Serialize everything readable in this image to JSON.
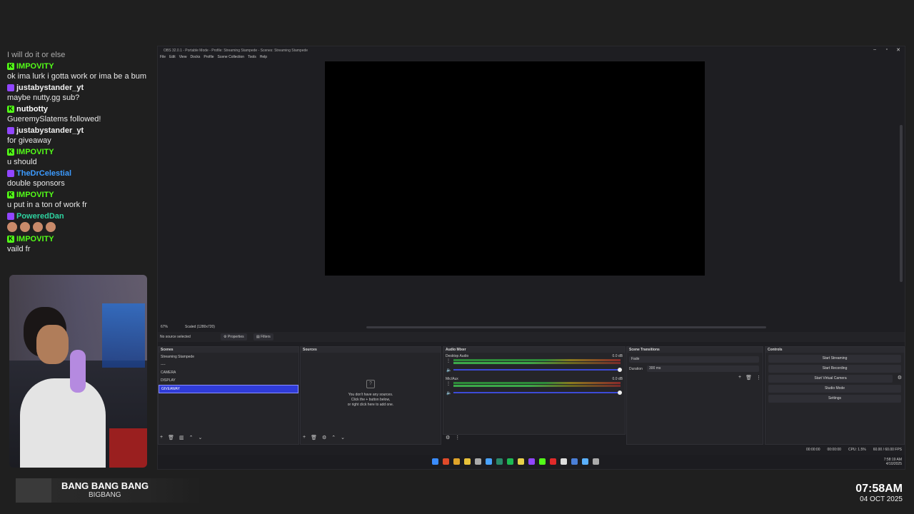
{
  "chat": {
    "messages": [
      {
        "kind": "text",
        "text": "I will do it or else"
      },
      {
        "kind": "user",
        "name": "IMPOVITY",
        "color": "#53fc18",
        "badge": "kick"
      },
      {
        "kind": "text",
        "text": "ok ima lurk i gotta work or ima be a bum"
      },
      {
        "kind": "user",
        "name": "justabystander_yt",
        "color": "#f0f0f0",
        "badge": "twitch"
      },
      {
        "kind": "text",
        "text": "maybe nutty.gg sub?"
      },
      {
        "kind": "user",
        "name": "nutbotty",
        "color": "#ffffff",
        "badge": "kick"
      },
      {
        "kind": "text",
        "text": "GueremySlatems followed!"
      },
      {
        "kind": "user",
        "name": "justabystander_yt",
        "color": "#f0f0f0",
        "badge": "twitch"
      },
      {
        "kind": "text",
        "text": "for giveaway"
      },
      {
        "kind": "user",
        "name": "IMPOVITY",
        "color": "#53fc18",
        "badge": "kick"
      },
      {
        "kind": "text",
        "text": "u should"
      },
      {
        "kind": "user",
        "name": "TheDrCelestial",
        "color": "#3c9bff",
        "badge": "twitch"
      },
      {
        "kind": "text",
        "text": "double sponsors"
      },
      {
        "kind": "user",
        "name": "IMPOVITY",
        "color": "#53fc18",
        "badge": "kick"
      },
      {
        "kind": "text",
        "text": "u put in a ton of work fr"
      },
      {
        "kind": "user",
        "name": "PoweredDan",
        "color": "#2ed3a0",
        "badge": "twitch"
      },
      {
        "kind": "emotes",
        "text": ""
      },
      {
        "kind": "user",
        "name": "IMPOVITY",
        "color": "#53fc18",
        "badge": "kick"
      },
      {
        "kind": "text",
        "text": "vaild fr"
      }
    ]
  },
  "now_playing": {
    "title": "BANG BANG BANG",
    "artist": "BIGBANG"
  },
  "clock": {
    "time": "07:58AM",
    "date": "04 OCT 2025"
  },
  "obs": {
    "title": "OBS 32.0.1 - Portable Mode - Profile: Streaming Stampede - Scenes: Streaming Stampede",
    "menu": [
      "File",
      "Edit",
      "View",
      "Docks",
      "Profile",
      "Scene Collection",
      "Tools",
      "Help"
    ],
    "zoom": "67%",
    "scaled": "Scaled (1280x720)",
    "no_source": "No source selected",
    "properties": "Properties",
    "filters": "Filters",
    "scenes": {
      "title": "Scenes",
      "items": [
        "Streaming Stampede",
        "----",
        "CAMERA",
        "DISPLAY",
        "GIVEAWAY"
      ],
      "selected": 4
    },
    "sources": {
      "title": "Sources",
      "empty_lines": [
        "You don't have any sources.",
        "Click the + button below,",
        "or right click here to add one."
      ]
    },
    "mixer": {
      "title": "Audio Mixer",
      "channels": [
        {
          "name": "Desktop Audio",
          "db": "0.0 dB"
        },
        {
          "name": "Mic/Aux",
          "db": "0.0 dB"
        }
      ]
    },
    "transitions": {
      "title": "Scene Transitions",
      "type": "Fade",
      "duration_label": "Duration",
      "duration": "300 ms"
    },
    "controls": {
      "title": "Controls",
      "buttons": [
        "Start Streaming",
        "Start Recording",
        "Start Virtual Camera",
        "Studio Mode",
        "Settings"
      ]
    },
    "status": {
      "t1": "00:00:00",
      "t2": "00:00:00",
      "cpu": "CPU: 1.5%",
      "fps": "60.00 / 60.00 FPS"
    }
  },
  "taskbar": {
    "time": "7:58:19 AM",
    "date": "4/10/2025"
  },
  "colors": {
    "accent": "#2f3bd8",
    "kick": "#53fc18",
    "twitch": "#9146ff"
  }
}
